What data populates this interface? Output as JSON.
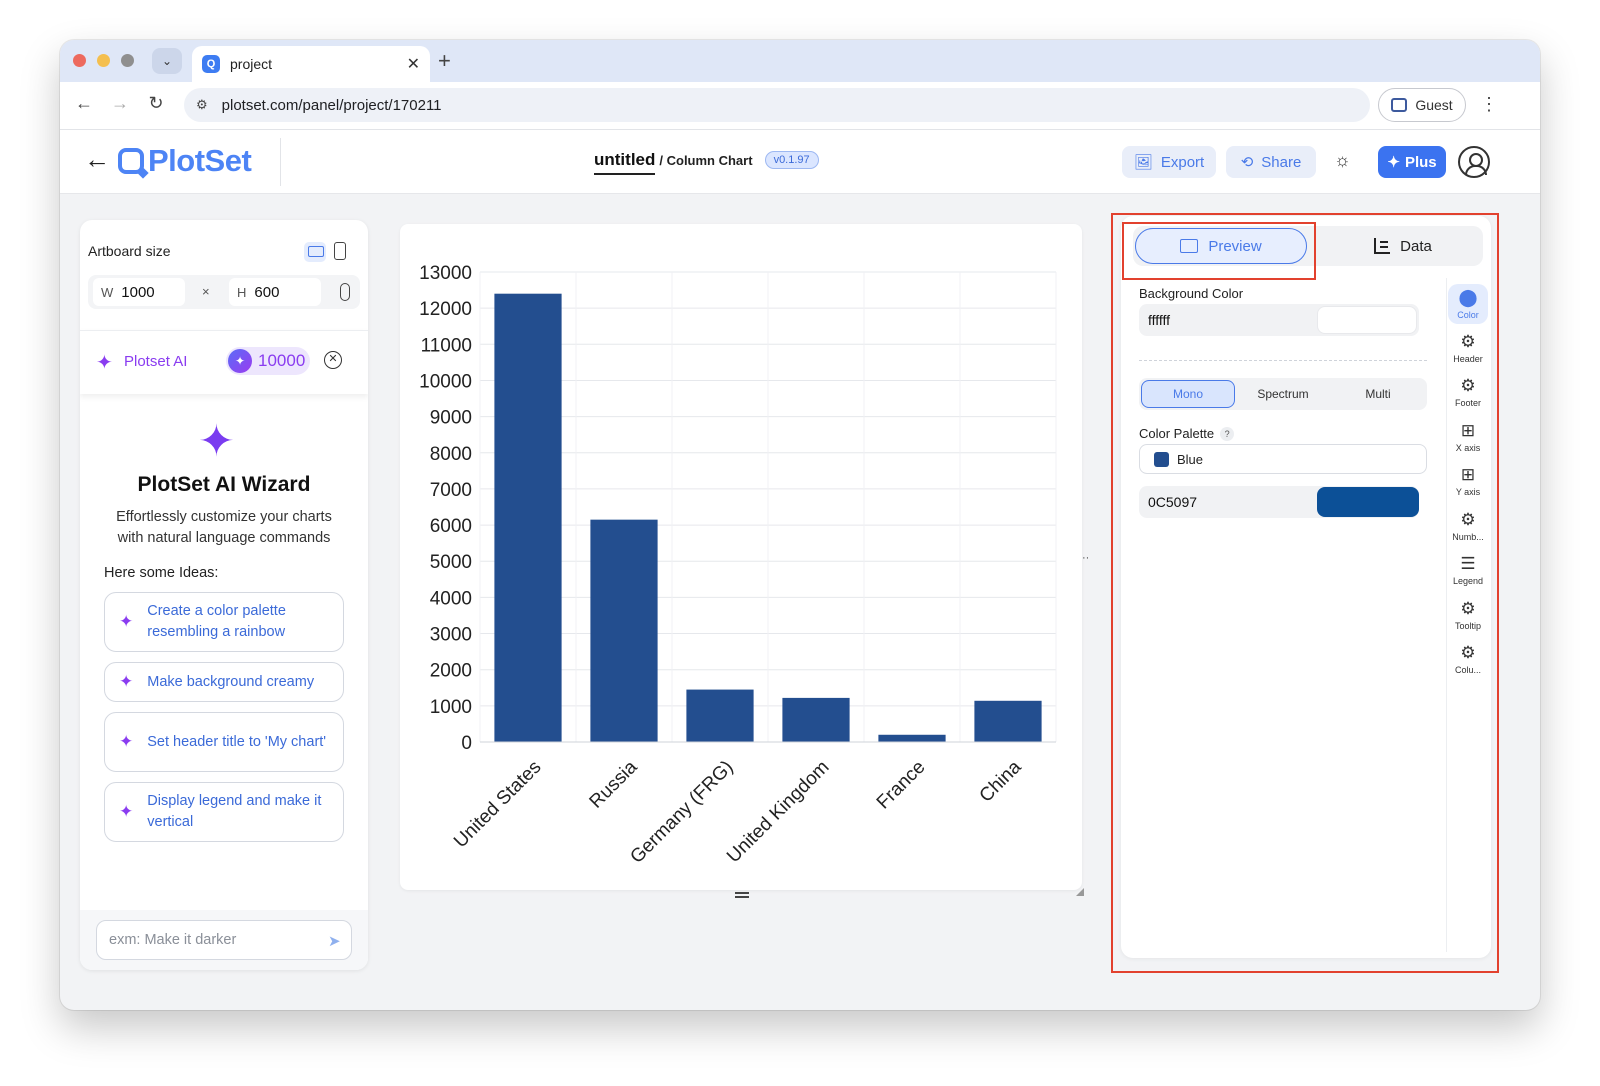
{
  "browser": {
    "tab_title": "project",
    "url": "plotset.com/panel/project/170211",
    "profile_label": "Guest"
  },
  "header": {
    "logo_text": "PlotSet",
    "doc_title": "untitled",
    "doc_type": "/ Column Chart",
    "version": "v0.1.97",
    "export_label": "Export",
    "share_label": "Share",
    "plus_label": "Plus"
  },
  "artboard": {
    "label": "Artboard size",
    "w_letter": "W",
    "w_value": "1000",
    "h_letter": "H",
    "h_value": "600",
    "times": "×"
  },
  "ai": {
    "label": "Plotset AI",
    "credits": "10000",
    "wizard_title": "PlotSet AI Wizard",
    "wizard_subtitle": "Effortlessly customize your charts with natural language commands",
    "ideas_label": "Here some Ideas:",
    "ideas": [
      "Create a color palette resembling a rainbow",
      "Make background creamy",
      "Set header title to 'My chart'",
      "Display legend and make it vertical"
    ],
    "prompt_placeholder": "exm: Make it darker"
  },
  "right_panel": {
    "tab_preview": "Preview",
    "tab_data": "Data",
    "bg_label": "Background Color",
    "bg_value": "ffffff",
    "modes": [
      "Mono",
      "Spectrum",
      "Multi"
    ],
    "active_mode": "Mono",
    "palette_label": "Color Palette",
    "help": "?",
    "palette_name": "Blue",
    "color_value": "0C5097",
    "colors": {
      "background": "#ffffff",
      "bar": "#0c5097"
    },
    "side_nav": [
      {
        "label": "Color",
        "icon": "palette-icon",
        "active": true
      },
      {
        "label": "Header",
        "icon": "gear-icon"
      },
      {
        "label": "Footer",
        "icon": "gear-icon"
      },
      {
        "label": "X axis",
        "icon": "grid-icon"
      },
      {
        "label": "Y axis",
        "icon": "grid-icon"
      },
      {
        "label": "Numb...",
        "icon": "gear-icon"
      },
      {
        "label": "Legend",
        "icon": "legend-icon"
      },
      {
        "label": "Tooltip",
        "icon": "gear-icon"
      },
      {
        "label": "Colu...",
        "icon": "gear-icon"
      }
    ]
  },
  "chart_data": {
    "type": "bar",
    "categories": [
      "United States",
      "Russia",
      "Germany (FRG)",
      "United Kingdom",
      "France",
      "China"
    ],
    "values": [
      12400,
      6150,
      1450,
      1220,
      200,
      1140
    ],
    "ylim": [
      0,
      13000
    ],
    "yticks": [
      0,
      1000,
      2000,
      3000,
      4000,
      5000,
      6000,
      7000,
      8000,
      9000,
      10000,
      11000,
      12000,
      13000
    ],
    "title": "",
    "xlabel": "",
    "ylabel": "",
    "grid": true,
    "bar_color": "#234e8f"
  }
}
